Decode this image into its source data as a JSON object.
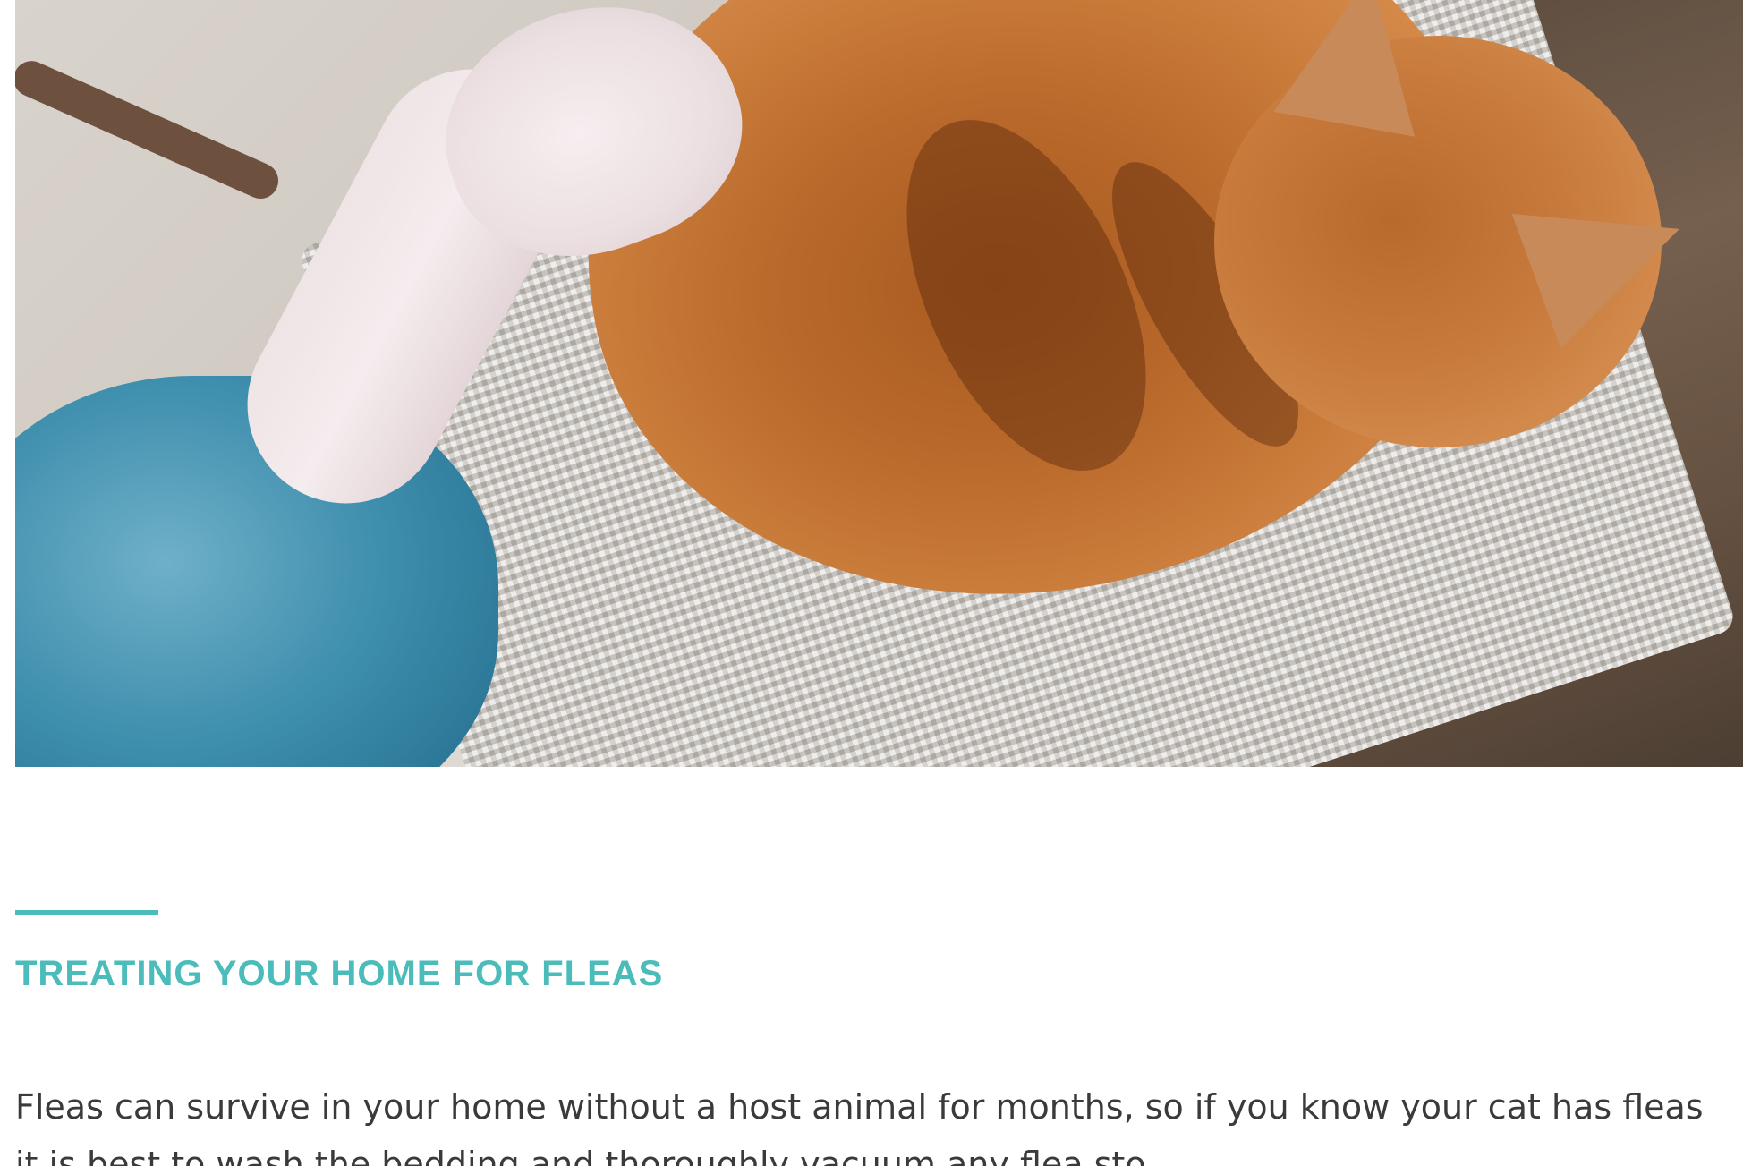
{
  "hero_image": {
    "alt": "",
    "icon": "photo-icon"
  },
  "article": {
    "section_title": "TREATING YOUR HOME FOR FLEAS",
    "paragraph": "Fleas can survive in your home without a host animal for months, so if you know your cat has fleas it is best to wash the bedding and thoroughly vacuum any flea sto..."
  },
  "colors": {
    "accent": "#4bbcba",
    "body_text": "#3a3a3a",
    "background": "#ffffff"
  }
}
